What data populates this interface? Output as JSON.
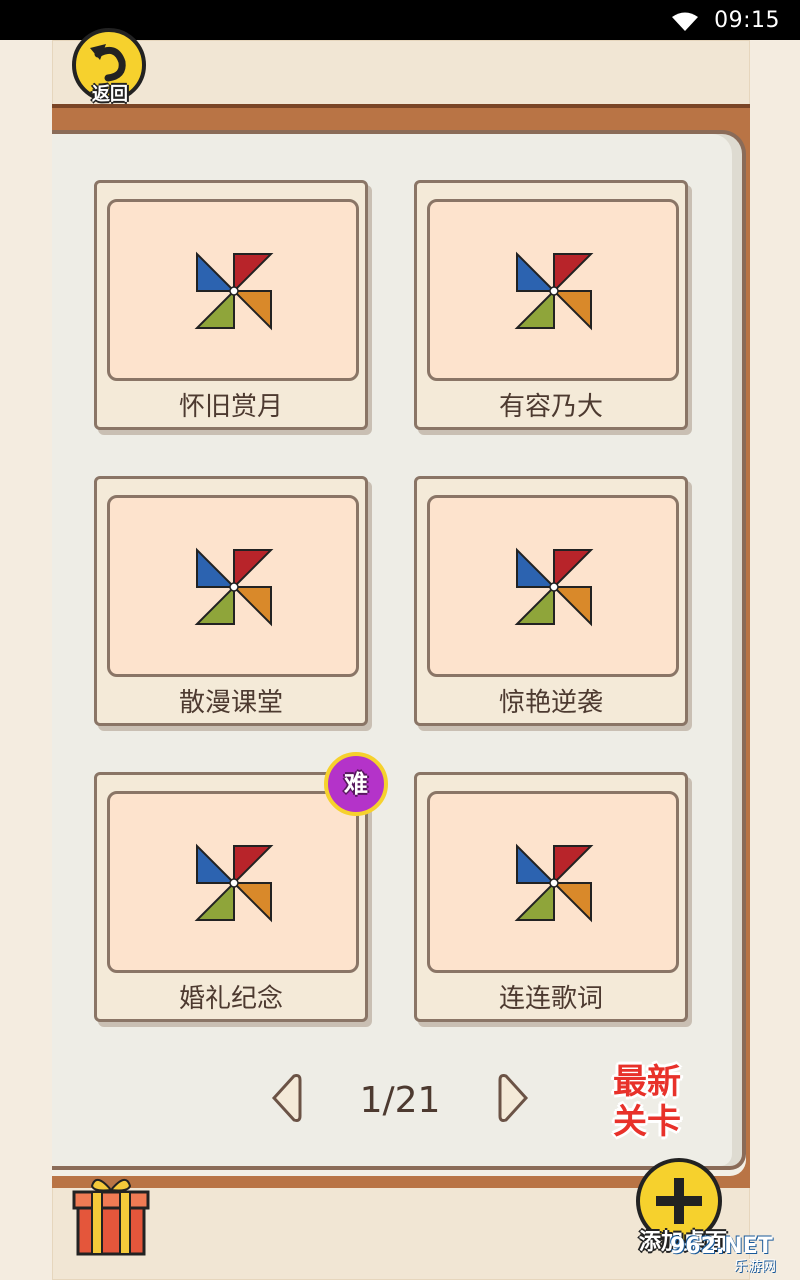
{
  "status_bar": {
    "time": "09:15"
  },
  "header": {
    "back_label": "返回"
  },
  "levels": [
    {
      "title": "怀旧赏月",
      "hard": false
    },
    {
      "title": "有容乃大",
      "hard": false
    },
    {
      "title": "散漫课堂",
      "hard": false
    },
    {
      "title": "惊艳逆袭",
      "hard": false
    },
    {
      "title": "婚礼纪念",
      "hard": true
    },
    {
      "title": "连连歌词",
      "hard": false
    }
  ],
  "hard_badge_label": "难",
  "pager": {
    "page": "1/21"
  },
  "newest_levels": {
    "line1": "最新",
    "line2": "关卡"
  },
  "add_desktop_label": "添加桌面",
  "watermark": {
    "main": "962.NET",
    "sub": "乐游网"
  },
  "icons": {
    "back": "undo-arrow-icon",
    "level": "pinwheel-icon",
    "gift": "gift-box-icon",
    "add": "plus-icon",
    "wifi": "wifi-icon"
  },
  "colors": {
    "accent_yellow": "#f6d12d",
    "hard_badge": "#b433c9",
    "newest_red": "#e8312a",
    "wood": "#b97445"
  }
}
